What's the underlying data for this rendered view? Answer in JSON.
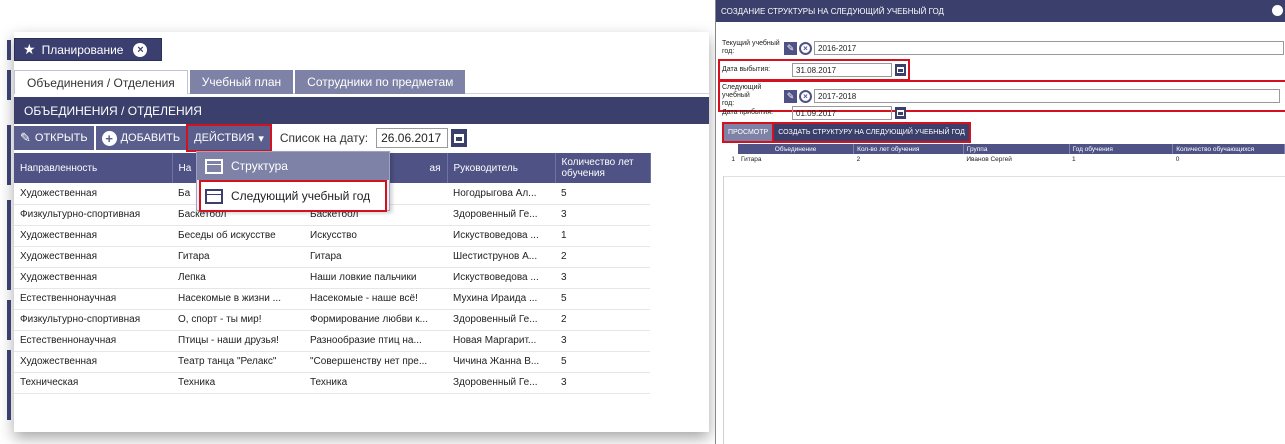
{
  "left": {
    "planning_tab": {
      "label": "Планирование"
    },
    "subtabs": [
      "Объединения / Отделения",
      "Учебный план",
      "Сотрудники по предметам"
    ],
    "section_title": "ОБЪЕДИНЕНИЯ / ОТДЕЛЕНИЯ",
    "toolbar": {
      "open_label": "ОТКРЫТЬ",
      "add_label": "ДОБАВИТЬ",
      "actions_label": "ДЕЙСТВИЯ",
      "date_label": "Список на дату:",
      "date_value": "26.06.2017"
    },
    "dropdown": {
      "items": [
        "Структура",
        "Следующий учебный год"
      ]
    },
    "table": {
      "headers": [
        "Направленность",
        "На",
        "ая",
        "Руководитель",
        "Количество лет обучения"
      ],
      "rows": [
        [
          "Художественная",
          "Ба",
          "",
          "Ногодрыгова Ал...",
          "5"
        ],
        [
          "Физкультурно-спортивная",
          "Баскетбол",
          "Баскетбол",
          "Здоровенный Ге...",
          "3"
        ],
        [
          "Художественная",
          "Беседы об искусстве",
          "Искусство",
          "Искуствоведова ...",
          "1"
        ],
        [
          "Художественная",
          "Гитара",
          "Гитара",
          "Шестиструнов А...",
          "2"
        ],
        [
          "Художественная",
          "Лепка",
          "Наши ловкие пальчики",
          "Искуствоведова ...",
          "3"
        ],
        [
          "Естественнонаучная",
          "Насекомые в жизни ...",
          "Насекомые - наше всё!",
          "Мухина Ираида ...",
          "5"
        ],
        [
          "Физкультурно-спортивная",
          "О, спорт - ты мир!",
          "Формирование любви к...",
          "Здоровенный Ге...",
          "2"
        ],
        [
          "Естественнонаучная",
          "Птицы - наши друзья!",
          "Разнообразие птиц на...",
          "Новая Маргарит...",
          "3"
        ],
        [
          "Художественная",
          "Театр танца \"Релакс\"",
          "\"Совершенству нет пре...",
          "Чичина Жанна В...",
          "5"
        ],
        [
          "Техническая",
          "Техника",
          "Техника",
          "Здоровенный Ге...",
          "3"
        ]
      ]
    }
  },
  "right": {
    "title": "СОЗДАНИЕ СТРУКТУРЫ НА СЛЕДУЮЩИЙ УЧЕБНЫЙ ГОД",
    "current_year": {
      "label_line1": "Текущий учебный",
      "label_line2": "год:",
      "value": "2016-2017"
    },
    "departure_date": {
      "label": "Дата выбытия:",
      "value": "31.08.2017"
    },
    "next_year": {
      "label_line1": "Следующий учебный",
      "label_line2": "год:",
      "value": "2017-2018"
    },
    "arrival_date": {
      "label": "Дата прибытия:",
      "value": "01.09.2017"
    },
    "buttons": {
      "view": "ПРОСМОТР",
      "create": "СОЗДАТЬ СТРУКТУРУ НА СЛЕДУЮЩИЙ УЧЕБНЫЙ ГОД"
    },
    "table": {
      "headers": [
        "Объединение",
        "Кол-во лет обучения",
        "Группа",
        "Год обучения",
        "Количество обучающихся"
      ],
      "rows": [
        {
          "num": "1",
          "cells": [
            "Гитара",
            "2",
            "Иванов Сергей",
            "1",
            "0"
          ]
        }
      ]
    }
  },
  "colors": {
    "header": "#3b3f6b",
    "accent": "#d4121e",
    "subtab": "#7e82a6"
  }
}
